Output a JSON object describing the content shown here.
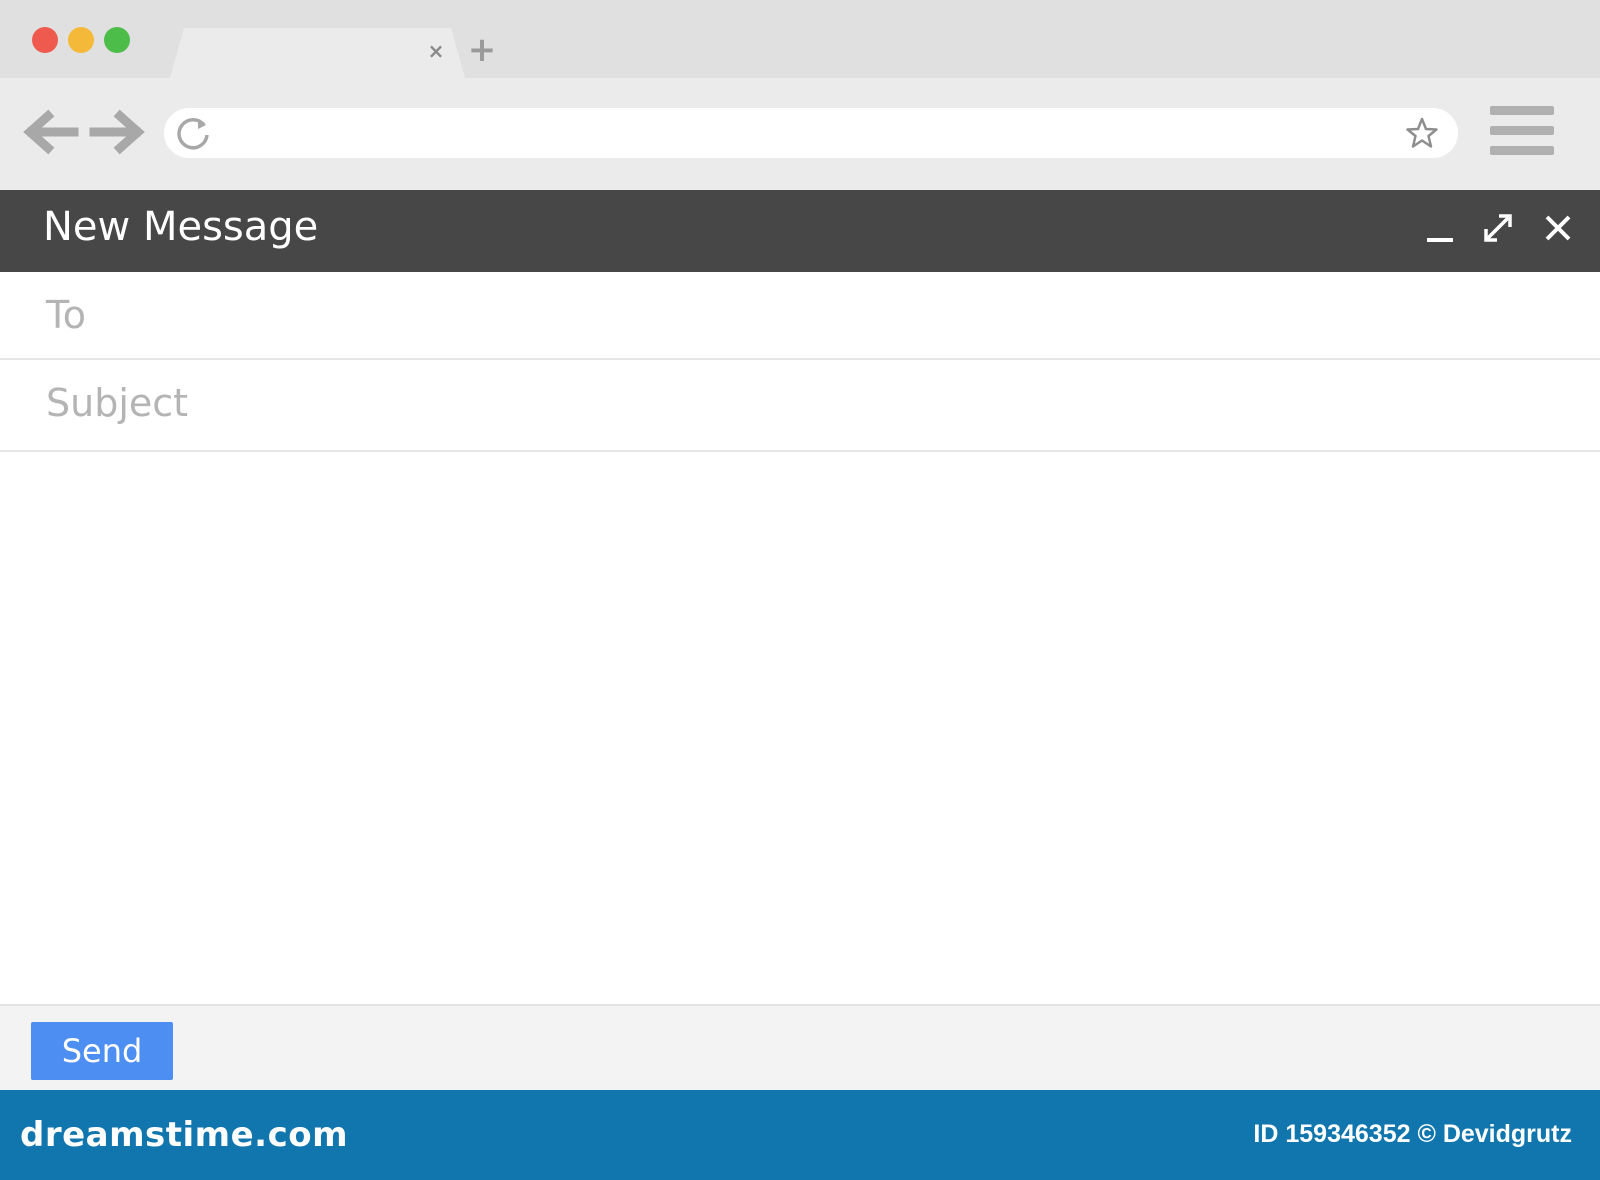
{
  "browser": {
    "tab": {
      "close_glyph": "×"
    },
    "new_tab_glyph": "+",
    "address_bar": {
      "value": "",
      "placeholder": ""
    },
    "icons": {
      "back": "arrow-left-icon",
      "forward": "arrow-right-icon",
      "reload": "reload-icon",
      "bookmark": "star-icon",
      "menu": "hamburger-menu-icon"
    },
    "traffic_lights": {
      "close": "#ef5a4e",
      "minimize": "#f5b93a",
      "zoom": "#4dbd49"
    }
  },
  "compose": {
    "title": "New Message",
    "to_label": "To",
    "subject_label": "Subject",
    "body_value": "",
    "send_label": "Send",
    "header_color": "#474747",
    "send_color": "#4d8ef2"
  },
  "banner": {
    "brand": "dreamstime.com",
    "credit": "ID 159346352 © Devidgrutz",
    "color": "#1176ae"
  }
}
